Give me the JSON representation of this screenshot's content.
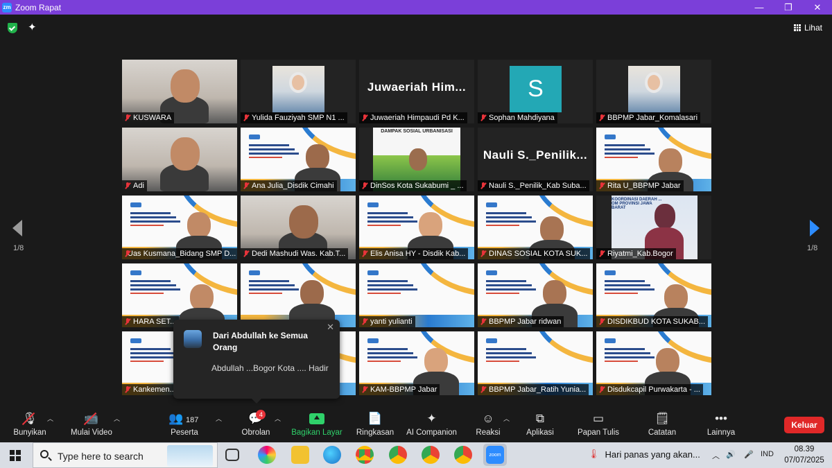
{
  "window": {
    "title": "Zoom Rapat",
    "controls": [
      "—",
      "❐",
      "✕"
    ]
  },
  "header": {
    "view_label": "Lihat"
  },
  "gallery": {
    "page_left": "1/8",
    "page_right": "1/8",
    "tiles": [
      {
        "name": "KUSWARA",
        "kind": "video"
      },
      {
        "name": "Yulida Fauziyah SMP N1 ...",
        "kind": "inset"
      },
      {
        "name": "Juwaeriah Himpaudi Pd K...",
        "kind": "text",
        "big": "Juwaeriah  Him..."
      },
      {
        "name": "Sophan Mahdiyana",
        "kind": "avatar",
        "letter": "S"
      },
      {
        "name": "BBPMP Jabar_Komalasari",
        "kind": "inset"
      },
      {
        "name": "Adi",
        "kind": "video"
      },
      {
        "name": "Ana Julia_Disdik Cimahi",
        "kind": "slide"
      },
      {
        "name": "DinSos Kota Sukabumi _ ...",
        "kind": "banner",
        "banner": "DAMPAK SOSIAL URBANISASI"
      },
      {
        "name": "Nauli S._Penilik_Kab Suba...",
        "kind": "text",
        "big": "Nauli S._Penilik..."
      },
      {
        "name": "Rita U_BBPMP Jabar",
        "kind": "slide"
      },
      {
        "name": "Uas Kusmana_Bidang SMP D...",
        "kind": "slide",
        "active": true
      },
      {
        "name": "Dedi Mashudi Was. Kab.T...",
        "kind": "video"
      },
      {
        "name": "Elis Anisa HY - Disdik Kab...",
        "kind": "slide"
      },
      {
        "name": "DINAS SOSIAL KOTA SUK...",
        "kind": "slide"
      },
      {
        "name": "Riyatmi_Kab.Bogor",
        "kind": "inset2",
        "banner": "KOORDINASI DAERAH ... OM PROVINSI JAWA BARAT"
      },
      {
        "name": "HARA SET...",
        "kind": "slide"
      },
      {
        "name": "",
        "kind": "slide"
      },
      {
        "name": "yanti yulianti",
        "kind": "slide"
      },
      {
        "name": "BBPMP Jabar ridwan",
        "kind": "slide"
      },
      {
        "name": "DISDIKBUD KOTA SUKAB...",
        "kind": "slide"
      },
      {
        "name": "Kankemen...",
        "kind": "slide"
      },
      {
        "name": "",
        "kind": "slide"
      },
      {
        "name": "KAM-BBPMP Jabar",
        "kind": "slide"
      },
      {
        "name": "BBPMP Jabar_Ratih Yunia...",
        "kind": "slide"
      },
      {
        "name": "Disdukcapil Purwakarta - ...",
        "kind": "slide"
      }
    ]
  },
  "chat_popup": {
    "from": "Dari Abdullah ke Semua Orang",
    "message": "Abdullah ...Bogor Kota .... Hadir"
  },
  "toolbar": {
    "mute": "Bunyikan",
    "video": "Mulai Video",
    "participants": "Peserta",
    "participants_count": "187",
    "chat": "Obrolan",
    "chat_badge": "4",
    "share": "Bagikan Layar",
    "summary": "Ringkasan",
    "ai": "AI Companion",
    "reactions": "Reaksi",
    "apps": "Aplikasi",
    "whiteboard": "Papan Tulis",
    "notes": "Catatan",
    "more": "Lainnya",
    "leave": "Keluar"
  },
  "taskbar": {
    "search_placeholder": "Type here to search",
    "weather": "Hari panas yang akan...",
    "lang": "IND",
    "time": "08.39",
    "date": "07/07/2025"
  },
  "colors": {
    "titlebar": "#7b3fd9",
    "accent": "#2d8cff",
    "share": "#2fd16a",
    "leave": "#e02828"
  }
}
